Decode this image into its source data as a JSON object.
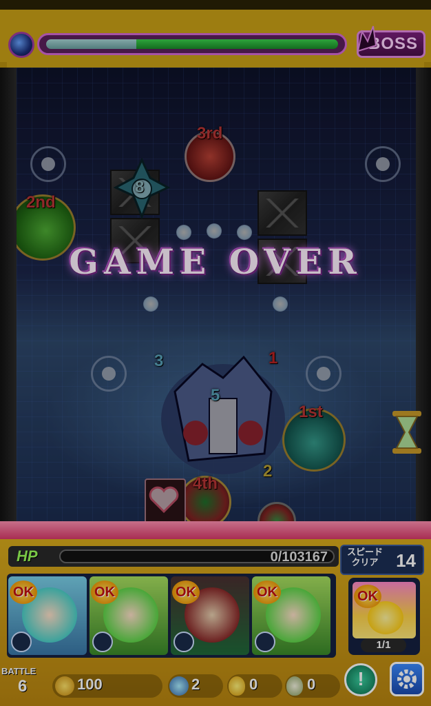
{
  "boss_bar": {
    "label": "BOSS",
    "hp_fraction": 0.31,
    "dim_fraction": 0.31
  },
  "field": {
    "overlay_text": "GAME OVER",
    "ranks": [
      "1st",
      "2nd",
      "3rd",
      "4th"
    ],
    "enemy_counters": [
      "8",
      "3",
      "1",
      "5",
      "2"
    ]
  },
  "player": {
    "hp_label": "HP",
    "hp_value": "0/103167",
    "hp_fraction": 0.0,
    "speed_label": "スピード クリア",
    "speed_value": "14"
  },
  "team": [
    {
      "ok": "OK",
      "face_color": "#4bd0c8"
    },
    {
      "ok": "OK",
      "face_color": "#5fd64a"
    },
    {
      "ok": "OK",
      "face_color": "#8a2a2a"
    },
    {
      "ok": "OK",
      "face_color": "#5fd64a"
    }
  ],
  "helper": {
    "ok": "OK",
    "count": "1/1"
  },
  "status": {
    "battle_label": "BATTLE",
    "battle_value": "6",
    "gold": "100",
    "gems": "2",
    "gold_eggs": "0",
    "eggs": "0"
  },
  "icons": {
    "pause": "exclamation-icon",
    "settings": "gear-icon"
  }
}
